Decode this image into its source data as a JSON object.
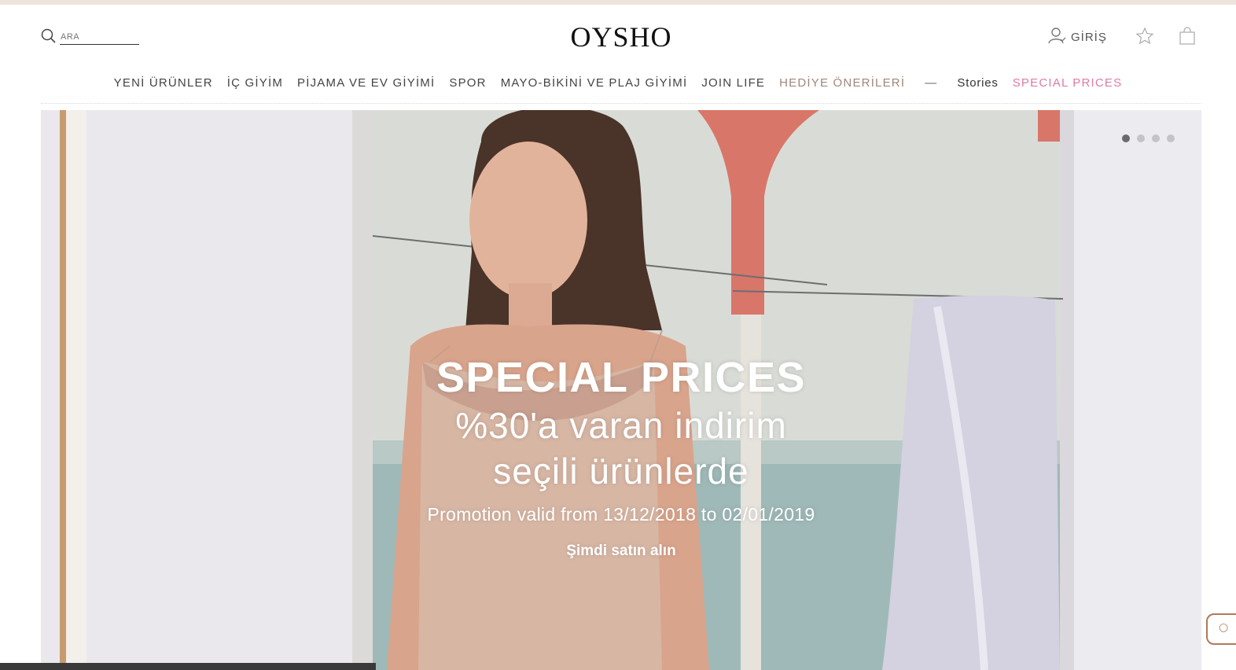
{
  "header": {
    "search_placeholder": "ARA",
    "logo": "OYSHO",
    "login_label": "GİRİŞ"
  },
  "nav": {
    "items": [
      "YENİ ÜRÜNLER",
      "İÇ GİYİM",
      "PİJAMA VE EV GİYİMİ",
      "SPOR",
      "MAYO-BİKİNİ VE PLAJ GİYİMİ",
      "JOIN LIFE",
      "HEDİYE ÖNERİLERİ",
      "—",
      "Stories",
      "SPECIAL PRICES"
    ]
  },
  "hero": {
    "title": "SPECIAL PRICES",
    "subtitle_line1": "%30'a varan indirim",
    "subtitle_line2": "seçili ürünlerde",
    "promo": "Promotion valid from 13/12/2018 to 02/01/2019",
    "cta": "Şimdi satın alın",
    "slides_count": 4,
    "active_slide": 1
  },
  "colors": {
    "topband": "#efe4dc",
    "gift_link": "#a0877a",
    "special_link": "#e07aa6",
    "chat_border": "#b07a58"
  },
  "icons": {
    "search": "search-icon",
    "user": "user-icon",
    "wishlist": "star-icon",
    "bag": "shopping-bag-icon",
    "chat": "chat-icon"
  }
}
